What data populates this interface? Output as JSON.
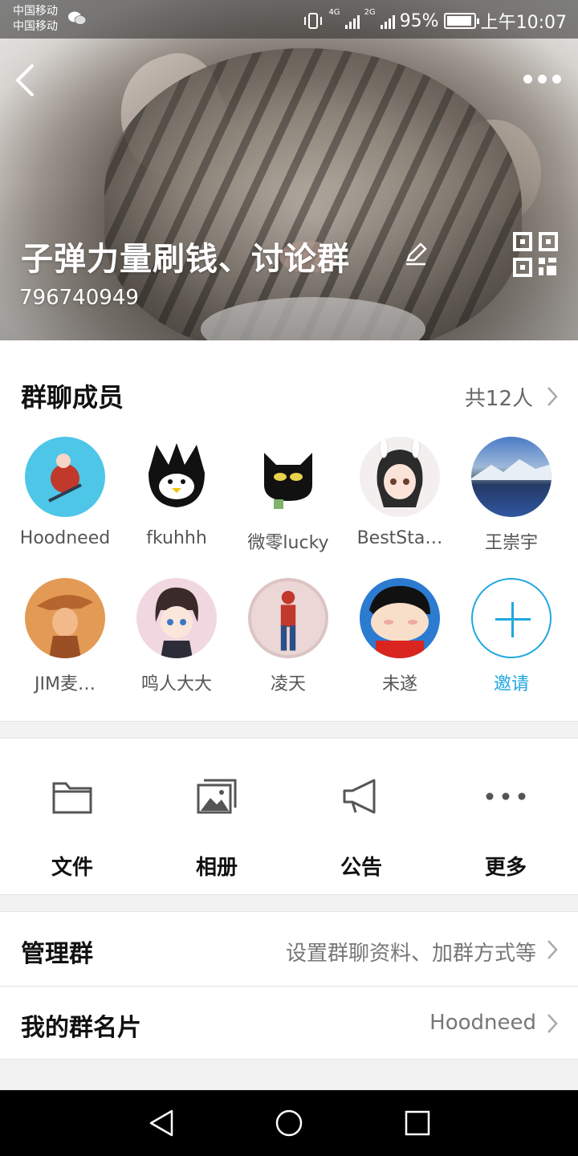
{
  "status_bar": {
    "carrier_1": "中国移动",
    "carrier_2": "中国移动",
    "net_1": "4G",
    "net_2": "2G",
    "battery": "95%",
    "time": "上午10:07"
  },
  "header": {
    "group_name": "子弹力量刷钱、讨论群",
    "group_id": "796740949"
  },
  "members": {
    "title": "群聊成员",
    "count": "共12人",
    "list": [
      {
        "name": "Hoodneed",
        "color": "#4ec6e8"
      },
      {
        "name": "fkuhhh",
        "color": "#ffffff"
      },
      {
        "name": "微零lucky",
        "color": "#ffffff"
      },
      {
        "name": "BestSta…",
        "color": "#f3efee"
      },
      {
        "name": "王崇宇",
        "color": "#3a62a8"
      },
      {
        "name": "JIM麦…",
        "color": "#e39a55"
      },
      {
        "name": "鸣人大大",
        "color": "#f1d8e0"
      },
      {
        "name": "凌天",
        "color": "#ecd7d7"
      },
      {
        "name": "未遂",
        "color": "#2b7bd1"
      }
    ],
    "invite_label": "邀请"
  },
  "functions": [
    {
      "label": "文件",
      "icon": "folder-icon"
    },
    {
      "label": "相册",
      "icon": "album-icon"
    },
    {
      "label": "公告",
      "icon": "megaphone-icon"
    },
    {
      "label": "更多",
      "icon": "more-dots-icon"
    }
  ],
  "rows": {
    "manage": {
      "label": "管理群",
      "value": "设置群聊资料、加群方式等"
    },
    "card": {
      "label": "我的群名片",
      "value": "Hoodneed"
    }
  },
  "colors": {
    "accent": "#1fa8e0"
  }
}
